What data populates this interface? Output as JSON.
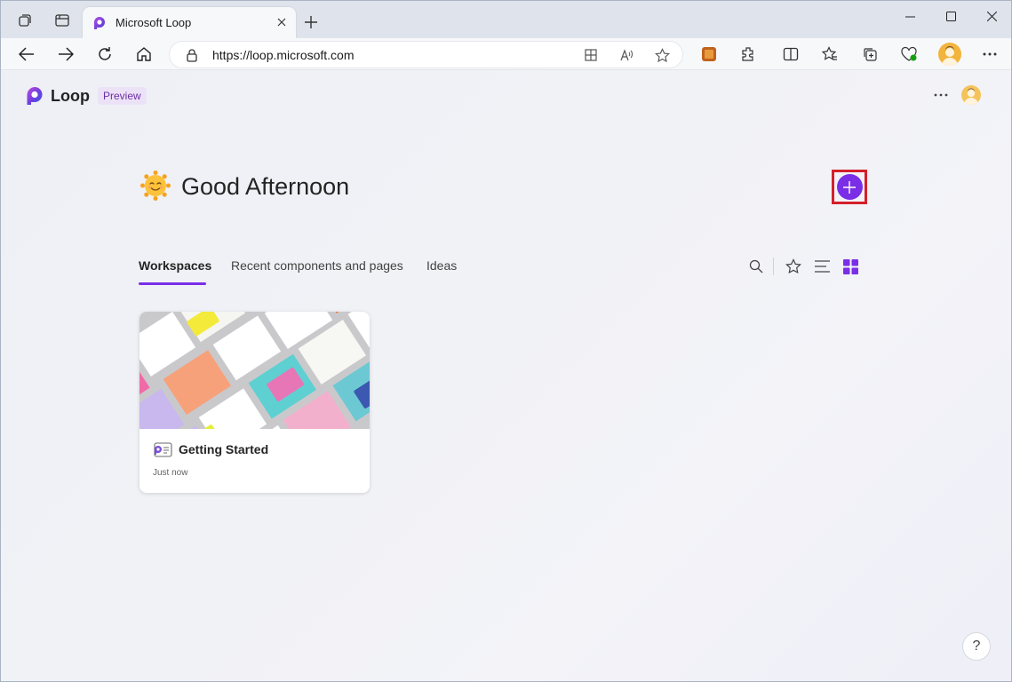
{
  "browser": {
    "tab": {
      "title": "Microsoft Loop",
      "favicon": "loop-favicon-icon"
    },
    "address_bar": {
      "url": "https://loop.microsoft.com"
    },
    "window_controls": [
      "minimize-icon",
      "maximize-icon",
      "close-icon"
    ]
  },
  "app": {
    "name": "Loop",
    "badge": "Preview",
    "greeting": "Good Afternoon",
    "greeting_emoji": "sun-face-icon",
    "accent_color": "#7a2ee6"
  },
  "tabs": [
    {
      "label": "Workspaces",
      "active": true
    },
    {
      "label": "Recent components and pages",
      "active": false
    },
    {
      "label": "Ideas",
      "active": false
    }
  ],
  "workspaces": [
    {
      "title": "Getting Started",
      "time": "Just now"
    }
  ],
  "help": {
    "label": "?"
  }
}
